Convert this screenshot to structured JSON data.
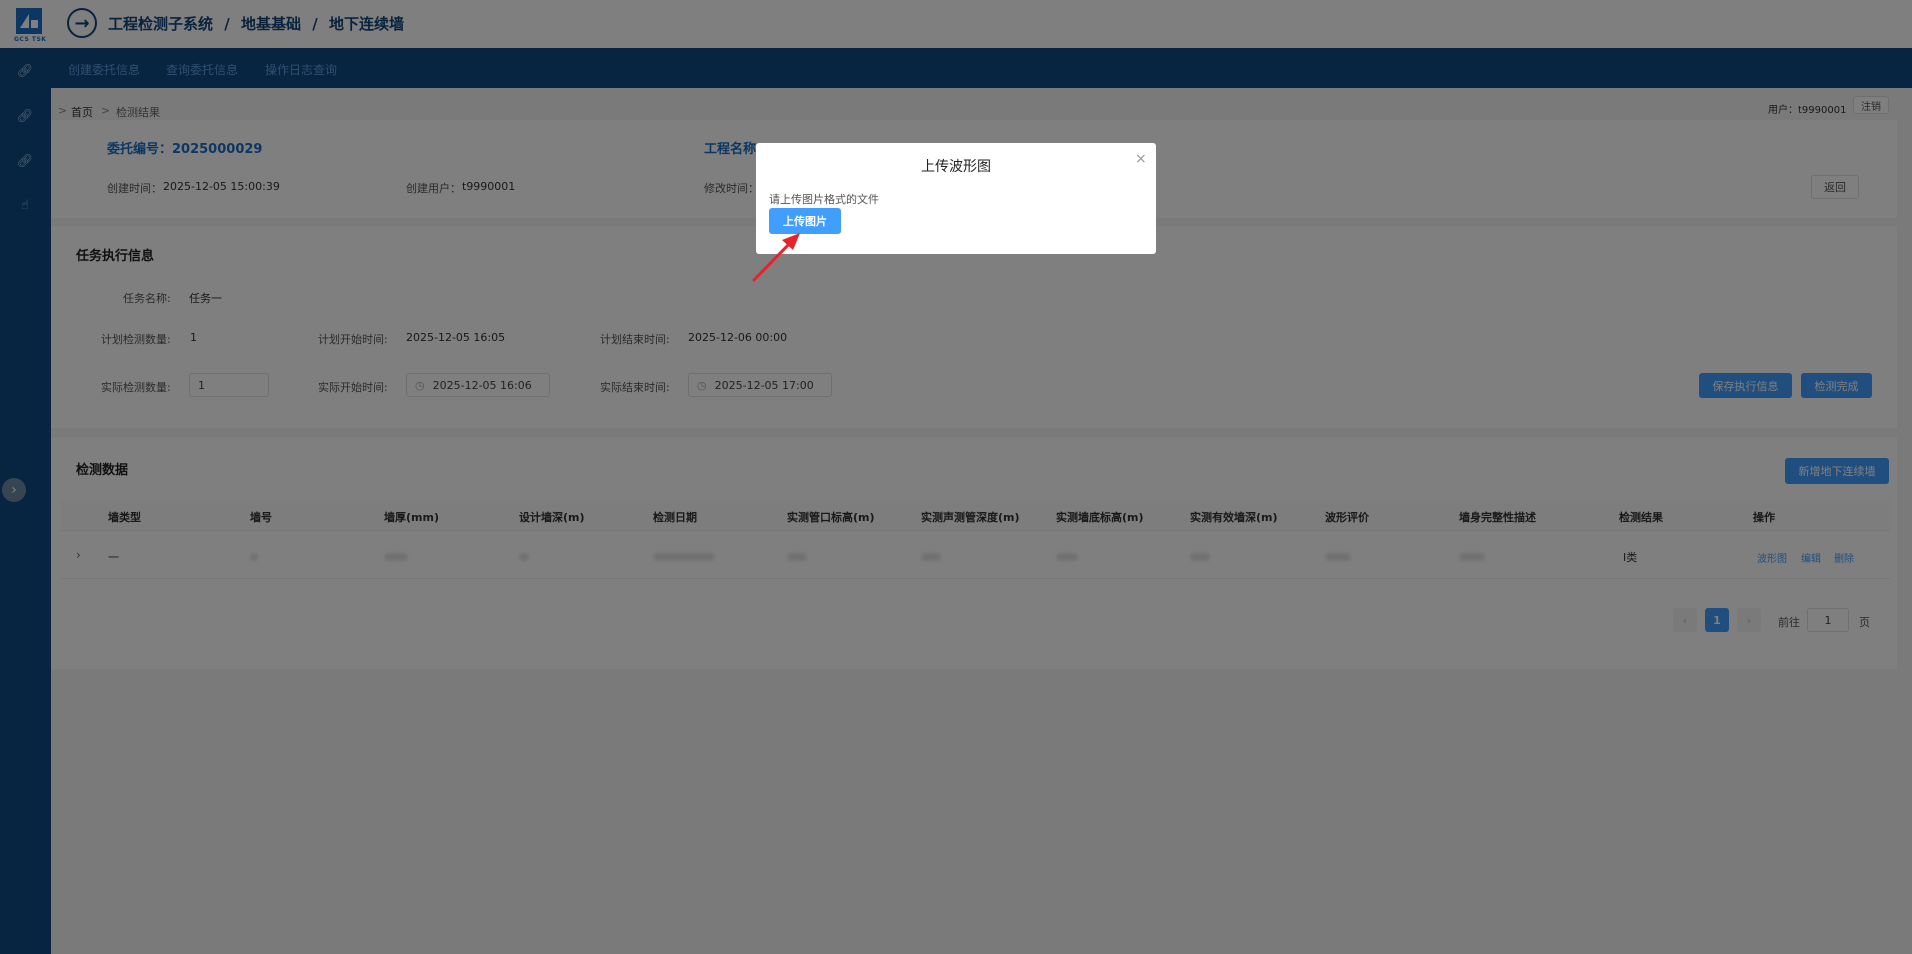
{
  "header": {
    "logo_text": "GCS TSK",
    "breadcrumb": [
      "工程检测子系统",
      "/",
      "地基基础",
      "/",
      "地下连续墙"
    ]
  },
  "nav": {
    "links": [
      "创建委托信息",
      "查询委托信息",
      "操作日志查询"
    ]
  },
  "page": {
    "crumb_home": "首页",
    "crumb_current": "检测结果",
    "crumb_sep": ">",
    "user_label": "用户：t9990001",
    "logout": "注销",
    "back": "返回"
  },
  "commission": {
    "number": "委托编号：2025000029",
    "project_name": "工程名称：",
    "created_time_label": "创建时间：",
    "created_time": "2025-12-05 15:00:39",
    "created_user_label": "创建用户：",
    "created_user": "t9990001",
    "modified_time_label": "修改时间："
  },
  "task": {
    "title": "任务执行信息",
    "name_label": "任务名称:",
    "name": "任务一",
    "plan_count_label": "计划检测数量:",
    "plan_count": "1",
    "plan_start_label": "计划开始时间:",
    "plan_start": "2025-12-05 16:05",
    "plan_end_label": "计划结束时间:",
    "plan_end": "2025-12-06 00:00",
    "actual_count_label": "实际检测数量:",
    "actual_count": "1",
    "actual_start_label": "实际开始时间:",
    "actual_start": "2025-12-05 16:06",
    "actual_end_label": "实际结束时间:",
    "actual_end": "2025-12-05 17:00",
    "save_btn": "保存执行信息",
    "done_btn": "检测完成"
  },
  "detection": {
    "title": "检测数据",
    "add_btn": "新增地下连续墙",
    "columns": [
      "墙类型",
      "墙号",
      "墙厚(mm)",
      "设计墙深(m)",
      "检测日期",
      "实测管口标高(m)",
      "实测声测管深度(m)",
      "实测墙底标高(m)",
      "实测有效墙深(m)",
      "波形评价",
      "墙身完整性描述",
      "检测结果",
      "操作"
    ],
    "row": {
      "expand": "›",
      "wall_type": "一",
      "result": "Ⅰ类",
      "actions": [
        "波形图",
        "编辑",
        "删除"
      ]
    }
  },
  "pagination": {
    "prev": "‹",
    "current": "1",
    "next": "›",
    "goto_label": "前往",
    "goto_value": "1",
    "page_unit": "页"
  },
  "modal": {
    "title": "上传波形图",
    "close": "×",
    "hint": "请上传图片格式的文件",
    "upload_btn": "上传图片"
  },
  "colors": {
    "primary": "#409eff",
    "sidebar": "#0e4a83",
    "annotation_arrow": "#e8222a"
  }
}
